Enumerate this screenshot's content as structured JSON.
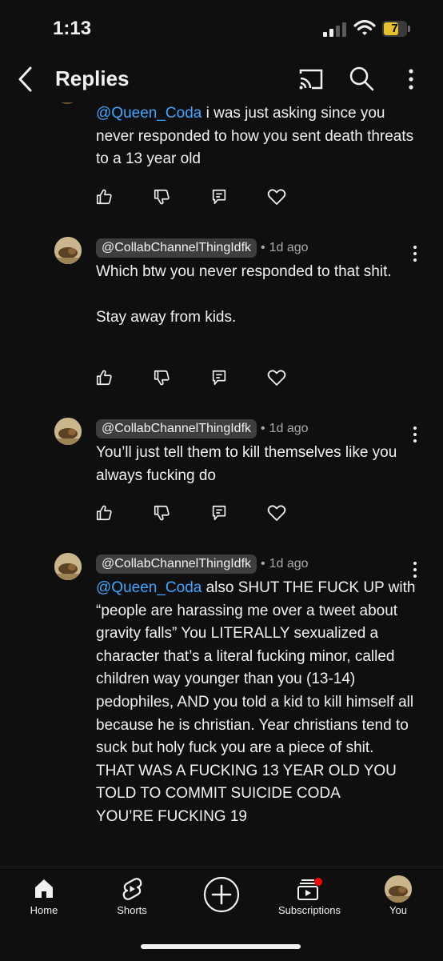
{
  "status_bar": {
    "time": "1:13",
    "battery_level": "7"
  },
  "header": {
    "title": "Replies"
  },
  "comments": [
    {
      "lines": [
        {
          "mention": "@Queen_Coda",
          "text": " i was just asking since you never responded to how you sent death threats to a 13 year old"
        }
      ]
    },
    {
      "handle": "@CollabChannelThingIdfk",
      "time": "1d ago",
      "lines": [
        {
          "mention": "",
          "text": "Which btw you never responded to that shit."
        },
        {
          "mention": "",
          "text": ""
        },
        {
          "mention": "",
          "text": "Stay away from kids."
        }
      ]
    },
    {
      "handle": "@CollabChannelThingIdfk",
      "time": "1d ago",
      "lines": [
        {
          "mention": "",
          "text": "You’ll just tell them to kill themselves like you always fucking do"
        }
      ]
    },
    {
      "handle": "@CollabChannelThingIdfk",
      "time": "1d ago",
      "lines": [
        {
          "mention": "@Queen_Coda",
          "text": " also SHUT THE FUCK UP with “people are harassing me over a tweet about gravity falls” You LITERALLY sexualized a character that’s a literal fucking minor, called children way younger than you (13-14) pedophiles, AND you told a kid to kill himself all because he is christian. Year christians tend to suck but holy fuck you are a piece of shit. THAT WAS A FUCKING 13 YEAR OLD YOU TOLD TO COMMIT SUICIDE CODA"
        },
        {
          "mention": "",
          "text": "YOU’RE FUCKING 19"
        }
      ]
    }
  ],
  "bottom_nav": {
    "home": "Home",
    "shorts": "Shorts",
    "subscriptions": "Subscriptions",
    "you": "You"
  },
  "colors": {
    "background": "#0f0f0f",
    "mention": "#3ea6ff",
    "handle_pill": "#3e3e3e",
    "notification_dot": "#ff0000",
    "battery": "#e5c12e"
  },
  "icons": [
    "back-icon",
    "cast-icon",
    "search-icon",
    "more-icon",
    "thumbs-up-icon",
    "thumbs-down-icon",
    "reply-icon",
    "heart-icon",
    "kebab-icon",
    "home-icon",
    "shorts-icon",
    "create-icon",
    "subscriptions-icon"
  ]
}
